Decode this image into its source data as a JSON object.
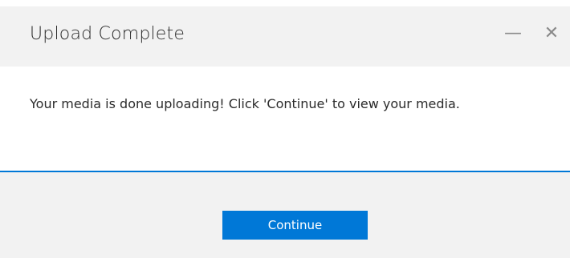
{
  "window": {
    "title": "Upload Complete",
    "minimize_glyph": "—",
    "close_glyph": "✕"
  },
  "message": "Your media is done uploading! Click 'Continue' to view your media.",
  "progress": {
    "value_percent": 100,
    "color": "#0078d7"
  },
  "footer": {
    "continue_label": "Continue"
  },
  "colors": {
    "accent": "#0078d7",
    "titlebar_bg": "#f2f2f2",
    "footer_bg": "#f2f2f2"
  }
}
